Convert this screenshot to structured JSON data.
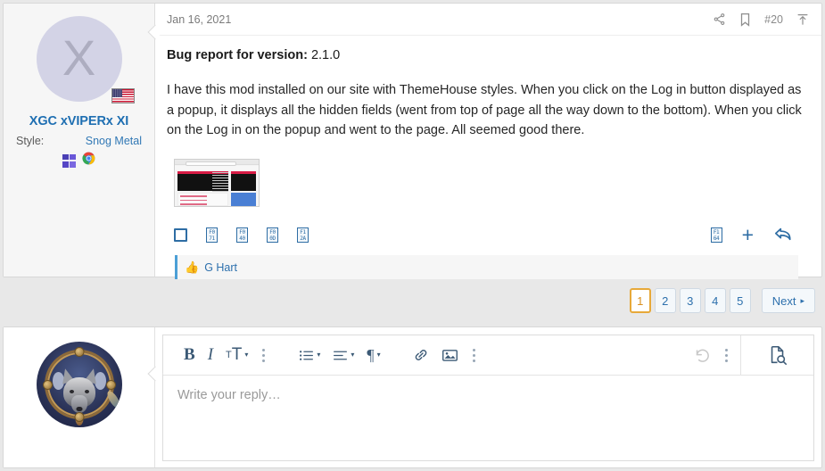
{
  "post": {
    "user": {
      "avatar_letter": "X",
      "avatar_icon": "avatar-placeholder-letter",
      "flag_icon": "us-flag-icon",
      "username": "XGC xVIPERx XI",
      "style_label": "Style:",
      "style_value": "Snog Metal",
      "os_icon": "windows-logo-icon",
      "browser_icon": "chrome-logo-icon",
      "username_color": "#1f6fb2"
    },
    "header": {
      "date": "Jan 16, 2021",
      "share_icon": "share-icon",
      "bookmark_icon": "bookmark-icon",
      "post_number": "#20",
      "jump_icon": "jump-to-top-icon"
    },
    "body": {
      "bug_label": "Bug report for version:",
      "bug_version": "2.1.0",
      "paragraph": "I have this mod installed on our site with ThemeHouse styles. When you click on the Log in button displayed as a popup, it displays all the hidden fields (went from top of page all the way down to the bottom). When you click on the Log in on the popup and went to the page. All seemed good there."
    },
    "attachment": {
      "name": "screenshot-thumbnail"
    },
    "actions": {
      "select_checkbox": "select-post-checkbox",
      "glyphs": [
        {
          "name": "report-icon",
          "hi": "F0",
          "lo": "71"
        },
        {
          "name": "quote-icon",
          "hi": "F0",
          "lo": "40"
        },
        {
          "name": "delete-icon",
          "hi": "F0",
          "lo": "0D"
        },
        {
          "name": "edit-icon",
          "hi": "F1",
          "lo": "2A"
        }
      ],
      "like_glyph": {
        "name": "like-thumbs-up-icon",
        "hi": "F1",
        "lo": "64"
      },
      "plus_label": "+",
      "reply_icon": "reply-arrow-icon"
    },
    "reactions": {
      "emoji": "👍",
      "names": "G Hart",
      "accent": "#4c9fd6"
    }
  },
  "pagination": {
    "pages": [
      "1",
      "2",
      "3",
      "4",
      "5"
    ],
    "current": "1",
    "next_label": "Next",
    "next_caret": "▸",
    "current_color": "#e7a93a",
    "link_color": "#2d70ad"
  },
  "reply": {
    "avatar_icon": "user-avatar-wolf-image",
    "toolbar": {
      "bold": "B",
      "italic": "I",
      "font_size": "T",
      "font_size_small": "T",
      "more_text_icon": "more-text-options-icon",
      "list_icon": "bullet-list-icon",
      "align_icon": "text-align-icon",
      "paragraph_icon": "¶",
      "more_block_icon": "more-block-options-icon",
      "link_icon": "insert-link-icon",
      "image_icon": "insert-image-icon",
      "more_insert_icon": "more-insert-options-icon",
      "undo_icon": "undo-icon",
      "more_actions_icon": "more-actions-icon",
      "preview_icon": "preview-document-icon",
      "caret": "▾"
    },
    "textarea_placeholder": "Write your reply…"
  }
}
